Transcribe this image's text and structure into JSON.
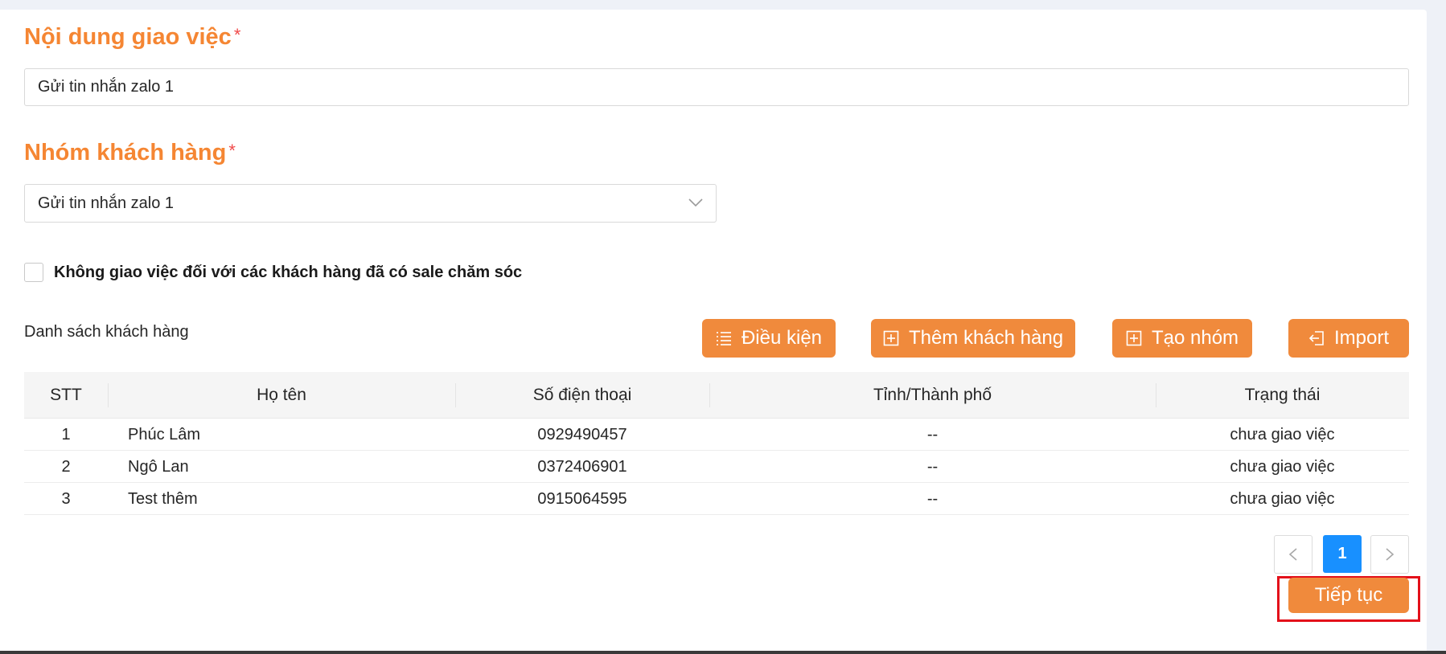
{
  "task_content": {
    "label": "Nội dung giao việc",
    "required_mark": "*",
    "value": "Gửi tin nhắn zalo 1"
  },
  "customer_group": {
    "label": "Nhóm khách hàng",
    "required_mark": "*",
    "selected": "Gửi tin nhắn zalo 1"
  },
  "skip_assigned": {
    "label": "Không giao việc đối với các khách hàng đã có sale chăm sóc",
    "checked": false
  },
  "customer_list": {
    "title": "Danh sách khách hàng",
    "buttons": {
      "conditions": "Điều kiện",
      "add_customer": "Thêm khách hàng",
      "create_group": "Tạo nhóm",
      "import": "Import"
    },
    "columns": [
      "STT",
      "Họ tên",
      "Số điện thoại",
      "Tỉnh/Thành phố",
      "Trạng thái"
    ],
    "rows": [
      {
        "stt": "1",
        "name": "Phúc Lâm",
        "phone": "0929490457",
        "city": "--",
        "status": "chưa giao việc"
      },
      {
        "stt": "2",
        "name": "Ngô Lan",
        "phone": "0372406901",
        "city": "--",
        "status": "chưa giao việc"
      },
      {
        "stt": "3",
        "name": "Test thêm",
        "phone": "0915064595",
        "city": "--",
        "status": "chưa giao việc"
      }
    ]
  },
  "pagination": {
    "current_page": "1"
  },
  "continue_label": "Tiếp tục",
  "colors": {
    "accent": "#f08a3c",
    "title": "#f58633",
    "required": "#f04a4a",
    "page_active": "#1890ff",
    "highlight_frame": "#e3101a"
  }
}
